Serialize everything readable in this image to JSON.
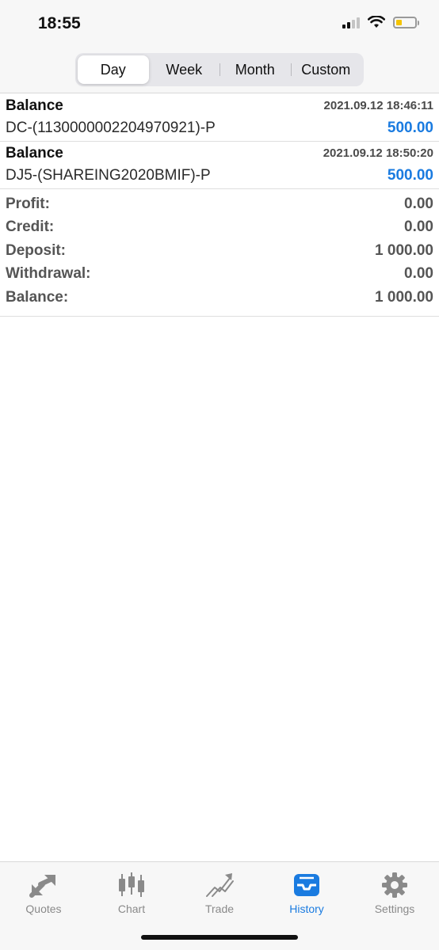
{
  "status_bar": {
    "time": "18:55",
    "battery_color": "#f5c400",
    "battery_level": 0.3
  },
  "period_tabs": [
    {
      "label": "Day",
      "active": true
    },
    {
      "label": "Week",
      "active": false
    },
    {
      "label": "Month",
      "active": false
    },
    {
      "label": "Custom",
      "active": false
    }
  ],
  "transactions": [
    {
      "type": "Balance",
      "time": "2021.09.12 18:46:11",
      "comment": "DC-(1130000002204970921)-P",
      "amount": "500.00"
    },
    {
      "type": "Balance",
      "time": "2021.09.12 18:50:20",
      "comment": "DJ5-(SHAREING2020BMIF)-P",
      "amount": "500.00"
    }
  ],
  "summary": [
    {
      "label": "Profit:",
      "value": "0.00"
    },
    {
      "label": "Credit:",
      "value": "0.00"
    },
    {
      "label": "Deposit:",
      "value": "1 000.00"
    },
    {
      "label": "Withdrawal:",
      "value": "0.00"
    },
    {
      "label": "Balance:",
      "value": "1 000.00"
    }
  ],
  "tabbar": [
    {
      "label": "Quotes",
      "icon": "quotes-icon",
      "active": false
    },
    {
      "label": "Chart",
      "icon": "chart-icon",
      "active": false
    },
    {
      "label": "Trade",
      "icon": "trade-icon",
      "active": false
    },
    {
      "label": "History",
      "icon": "history-icon",
      "active": true
    },
    {
      "label": "Settings",
      "icon": "settings-icon",
      "active": false
    }
  ],
  "colors": {
    "accent": "#1a7be0",
    "inactive": "#8a8a8a"
  }
}
